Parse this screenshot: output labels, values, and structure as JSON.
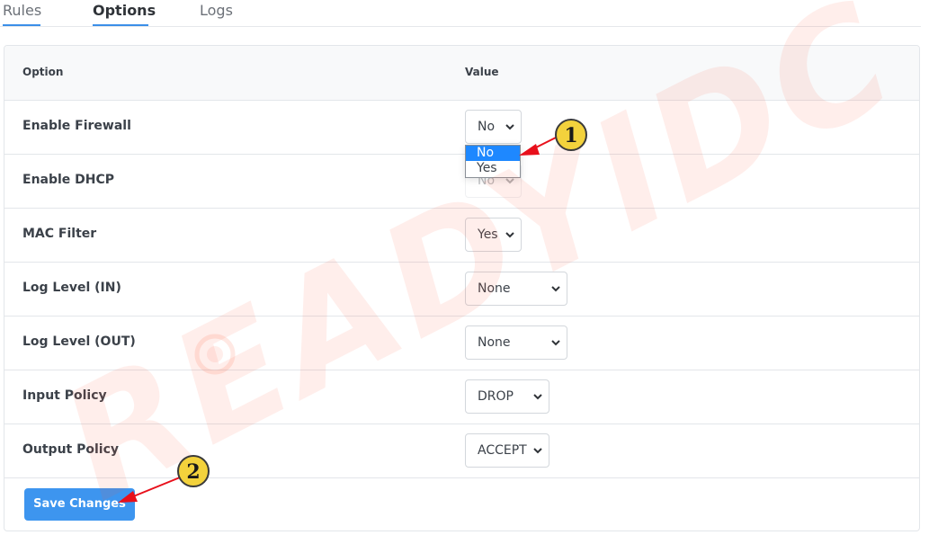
{
  "tabs": [
    {
      "label": "Rules"
    },
    {
      "label": "Options"
    },
    {
      "label": "Logs"
    }
  ],
  "table": {
    "col_option": "Option",
    "col_value": "Value",
    "rows": [
      {
        "label": "Enable Firewall",
        "value": "No"
      },
      {
        "label": "Enable DHCP",
        "value": "No"
      },
      {
        "label": "MAC Filter",
        "value": "Yes"
      },
      {
        "label": "Log Level (IN)",
        "value": "None"
      },
      {
        "label": "Log Level (OUT)",
        "value": "None"
      },
      {
        "label": "Input Policy",
        "value": "DROP"
      },
      {
        "label": "Output Policy",
        "value": "ACCEPT"
      }
    ]
  },
  "dropdown": {
    "options": [
      "No",
      "Yes"
    ],
    "highlighted": "No"
  },
  "save_label": "Save Changes",
  "annotations": {
    "step1": "1",
    "step2": "2"
  },
  "watermark": {
    "text": "READYIDC"
  },
  "colors": {
    "accent": "#3d95ef",
    "highlight": "#1e88ff",
    "arrow": "#e8101b",
    "badge": "#f3d23c"
  }
}
